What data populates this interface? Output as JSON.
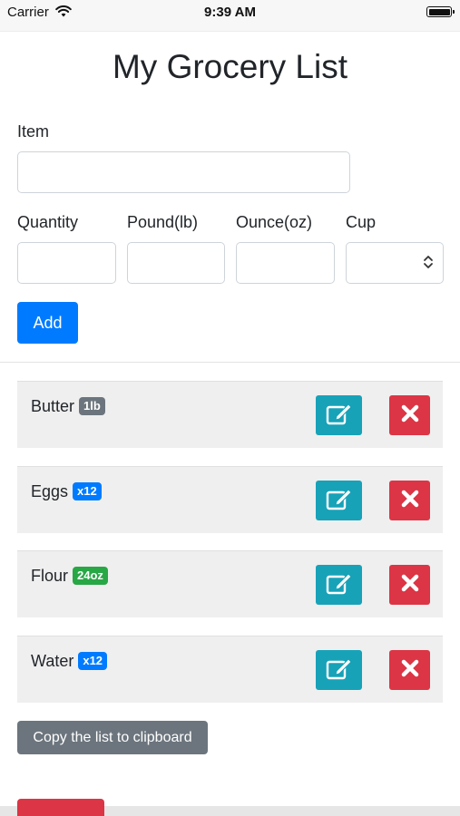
{
  "status_bar": {
    "carrier": "Carrier",
    "time": "9:39 AM"
  },
  "page": {
    "title": "My Grocery List"
  },
  "form": {
    "item_label": "Item",
    "item_value": "",
    "quantity_label": "Quantity",
    "quantity_value": "",
    "pound_label": "Pound(lb)",
    "pound_value": "",
    "ounce_label": "Ounce(oz)",
    "ounce_value": "",
    "cup_label": "Cup",
    "cup_value": "",
    "add_label": "Add"
  },
  "list": [
    {
      "name": "Butter",
      "badge": "1lb",
      "badge_color": "#6c757d"
    },
    {
      "name": "Eggs",
      "badge": "x12",
      "badge_color": "#007bff"
    },
    {
      "name": "Flour",
      "badge": "24oz",
      "badge_color": "#28a745"
    },
    {
      "name": "Water",
      "badge": "x12",
      "badge_color": "#007bff"
    }
  ],
  "actions": {
    "copy_label": "Copy the list to clipboard"
  },
  "icons": {
    "edit": "edit-icon",
    "delete": "close-icon",
    "select_caret": "chevron-updown-icon",
    "wifi": "wifi-icon",
    "battery": "battery-icon"
  },
  "colors": {
    "primary": "#007bff",
    "info": "#17a2b8",
    "danger": "#dc3545",
    "secondary": "#6c757d",
    "success": "#28a745"
  }
}
